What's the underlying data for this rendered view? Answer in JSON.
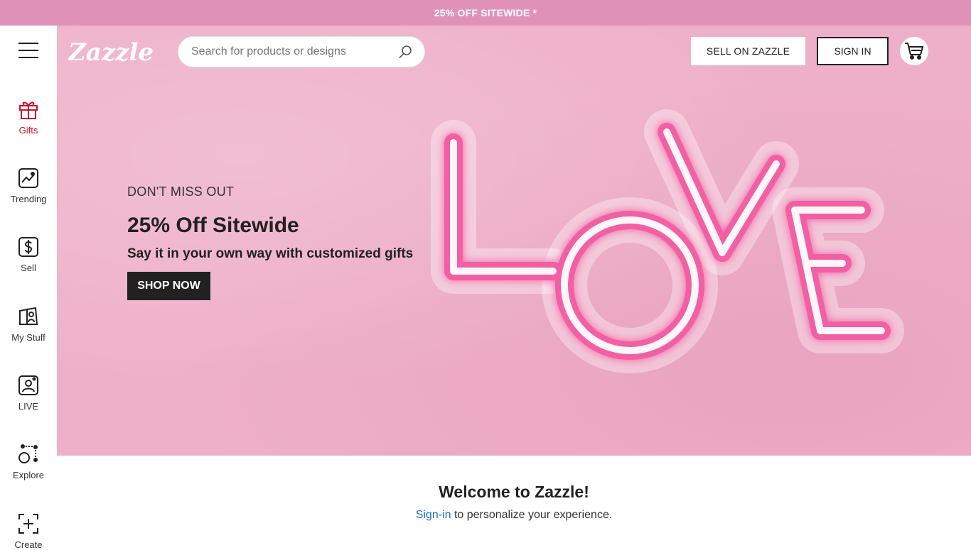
{
  "promo": {
    "text": "25% OFF SITEWIDE *"
  },
  "header": {
    "logo_text": "Zazzle",
    "search_placeholder": "Search for products or designs",
    "sell_label": "SELL ON ZAZZLE",
    "signin_label": "SIGN IN"
  },
  "sidebar": {
    "items": [
      {
        "label": "Gifts",
        "icon": "gift-icon"
      },
      {
        "label": "Trending",
        "icon": "trending-icon"
      },
      {
        "label": "Sell",
        "icon": "dollar-icon"
      },
      {
        "label": "My Stuff",
        "icon": "my-stuff-icon"
      },
      {
        "label": "LIVE",
        "icon": "live-icon"
      },
      {
        "label": "Explore",
        "icon": "explore-icon"
      },
      {
        "label": "Create",
        "icon": "create-icon"
      }
    ]
  },
  "hero": {
    "eyebrow": "DON'T MISS OUT",
    "headline": "25% Off Sitewide",
    "subline": "Say it in your own way with customized gifts",
    "cta": "SHOP NOW",
    "art_text": "LOVE"
  },
  "welcome": {
    "title": "Welcome to Zazzle!",
    "signin_link": "Sign-in",
    "rest": " to personalize your experience."
  },
  "colors": {
    "promo_bg": "#e192b8",
    "hero_bg": "#eeb0c8",
    "active_nav": "#c8102e",
    "link": "#1a73c8"
  }
}
